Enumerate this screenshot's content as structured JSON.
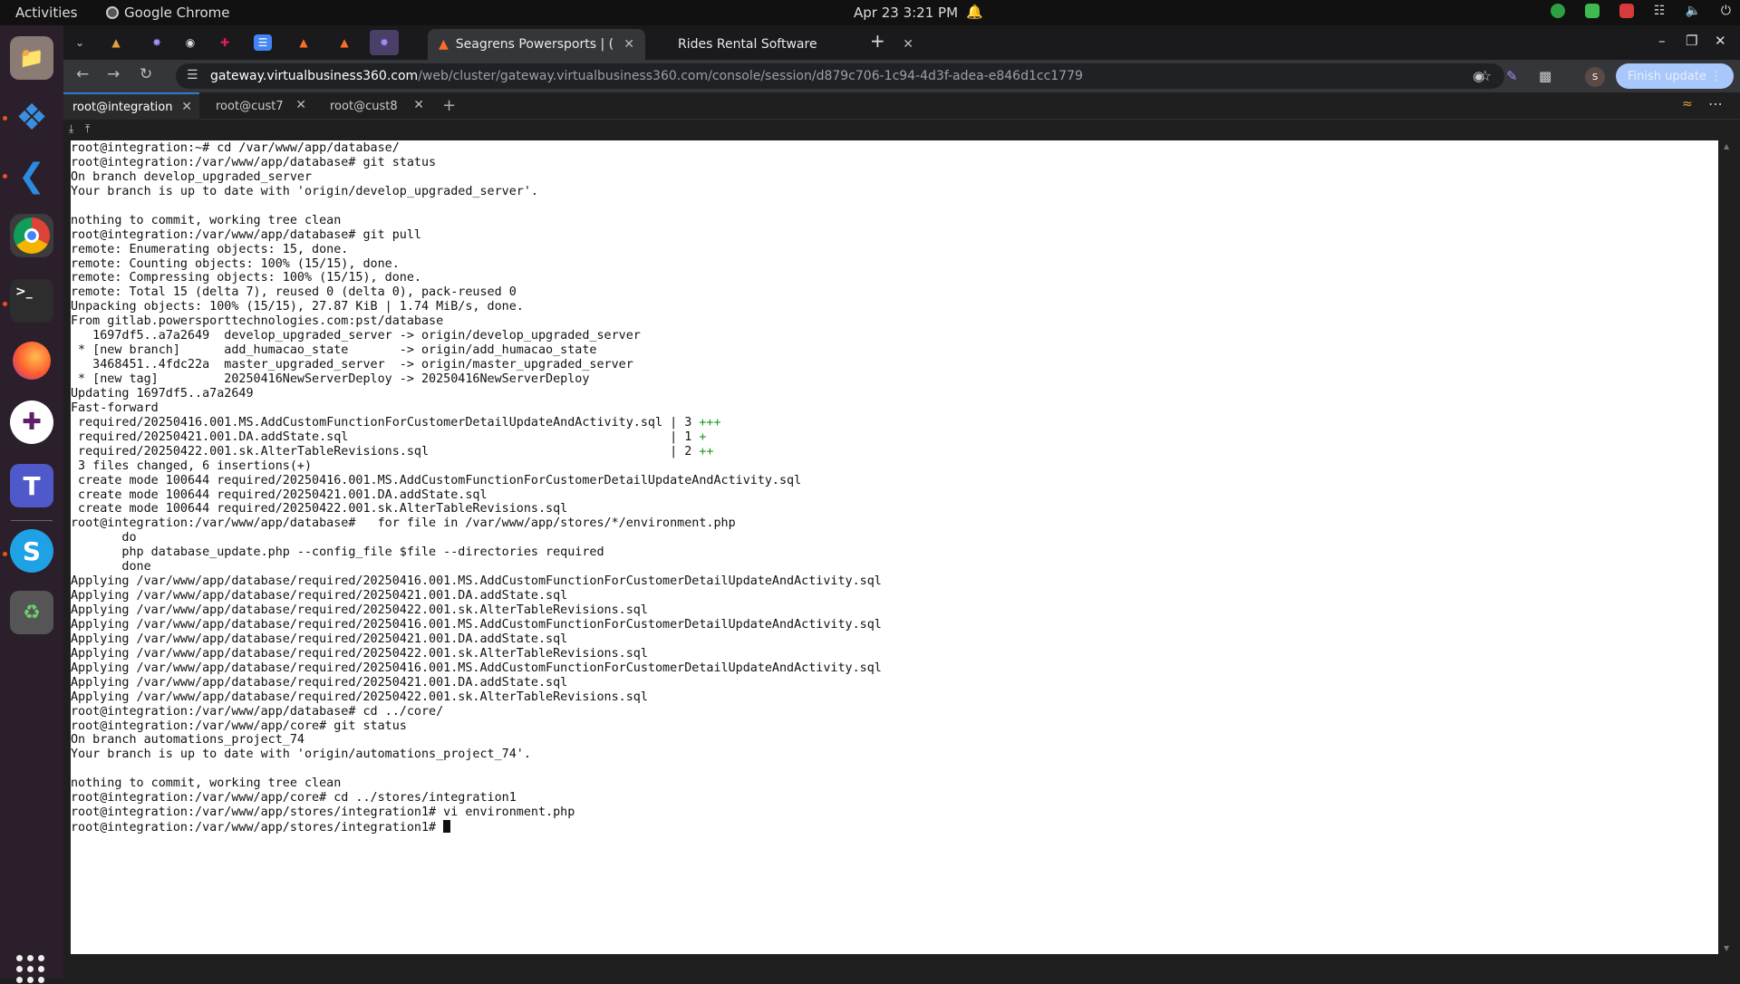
{
  "topbar": {
    "activities": "Activities",
    "app_name": "Google Chrome",
    "clock": "Apr 23  3:21 PM"
  },
  "browser": {
    "tabs": [
      {
        "title": "Seagrens Powersports | (",
        "active": true
      },
      {
        "title": "Rides Rental Software",
        "active": false
      }
    ],
    "url_host": "gateway.virtualbusiness360.com",
    "url_path": "/web/cluster/gateway.virtualbusiness360.com/console/session/d879c706-1c94-4d3f-adea-e846d1cc1779",
    "profile_initial": "S",
    "finish_update": "Finish update"
  },
  "terminal_tabs": [
    {
      "label": "root@integration",
      "active": true
    },
    {
      "label": "root@cust7",
      "active": false
    },
    {
      "label": "root@cust8",
      "active": false
    }
  ],
  "terminal_lines": [
    "root@integration:~# cd /var/www/app/database/",
    "root@integration:/var/www/app/database# git status",
    "On branch develop_upgraded_server",
    "Your branch is up to date with 'origin/develop_upgraded_server'.",
    "",
    "nothing to commit, working tree clean",
    "root@integration:/var/www/app/database# git pull",
    "remote: Enumerating objects: 15, done.",
    "remote: Counting objects: 100% (15/15), done.",
    "remote: Compressing objects: 100% (15/15), done.",
    "remote: Total 15 (delta 7), reused 0 (delta 0), pack-reused 0",
    "Unpacking objects: 100% (15/15), 27.87 KiB | 1.74 MiB/s, done.",
    "From gitlab.powersporttechnologies.com:pst/database",
    "   1697df5..a7a2649  develop_upgraded_server -> origin/develop_upgraded_server",
    " * [new branch]      add_humacao_state       -> origin/add_humacao_state",
    "   3468451..4fdc22a  master_upgraded_server  -> origin/master_upgraded_server",
    " * [new tag]         20250416NewServerDeploy -> 20250416NewServerDeploy",
    "Updating 1697df5..a7a2649",
    "Fast-forward",
    " required/20250416.001.MS.AddCustomFunctionForCustomerDetailUpdateAndActivity.sql | 3 ",
    " required/20250421.001.DA.addState.sql                                            | 1 ",
    " required/20250422.001.sk.AlterTableRevisions.sql                                 | 2 ",
    " 3 files changed, 6 insertions(+)",
    " create mode 100644 required/20250416.001.MS.AddCustomFunctionForCustomerDetailUpdateAndActivity.sql",
    " create mode 100644 required/20250421.001.DA.addState.sql",
    " create mode 100644 required/20250422.001.sk.AlterTableRevisions.sql",
    "root@integration:/var/www/app/database#   for file in /var/www/app/stores/*/environment.php",
    "       do",
    "       php database_update.php --config_file $file --directories required",
    "       done",
    "Applying /var/www/app/database/required/20250416.001.MS.AddCustomFunctionForCustomerDetailUpdateAndActivity.sql",
    "Applying /var/www/app/database/required/20250421.001.DA.addState.sql",
    "Applying /var/www/app/database/required/20250422.001.sk.AlterTableRevisions.sql",
    "Applying /var/www/app/database/required/20250416.001.MS.AddCustomFunctionForCustomerDetailUpdateAndActivity.sql",
    "Applying /var/www/app/database/required/20250421.001.DA.addState.sql",
    "Applying /var/www/app/database/required/20250422.001.sk.AlterTableRevisions.sql",
    "Applying /var/www/app/database/required/20250416.001.MS.AddCustomFunctionForCustomerDetailUpdateAndActivity.sql",
    "Applying /var/www/app/database/required/20250421.001.DA.addState.sql",
    "Applying /var/www/app/database/required/20250422.001.sk.AlterTableRevisions.sql",
    "root@integration:/var/www/app/database# cd ../core/",
    "root@integration:/var/www/app/core# git status",
    "On branch automations_project_74",
    "Your branch is up to date with 'origin/automations_project_74'.",
    "",
    "nothing to commit, working tree clean",
    "root@integration:/var/www/app/core# cd ../stores/integration1",
    "root@integration:/var/www/app/stores/integration1# vi environment.php",
    "root@integration:/var/www/app/stores/integration1# "
  ],
  "diffstat_plus": {
    "19": "+++",
    "20": "+",
    "21": "++"
  },
  "colors": {
    "accent": "#2e7bd6",
    "diff_plus": "#1a9a1a",
    "terminal_bg": "#ffffff"
  }
}
